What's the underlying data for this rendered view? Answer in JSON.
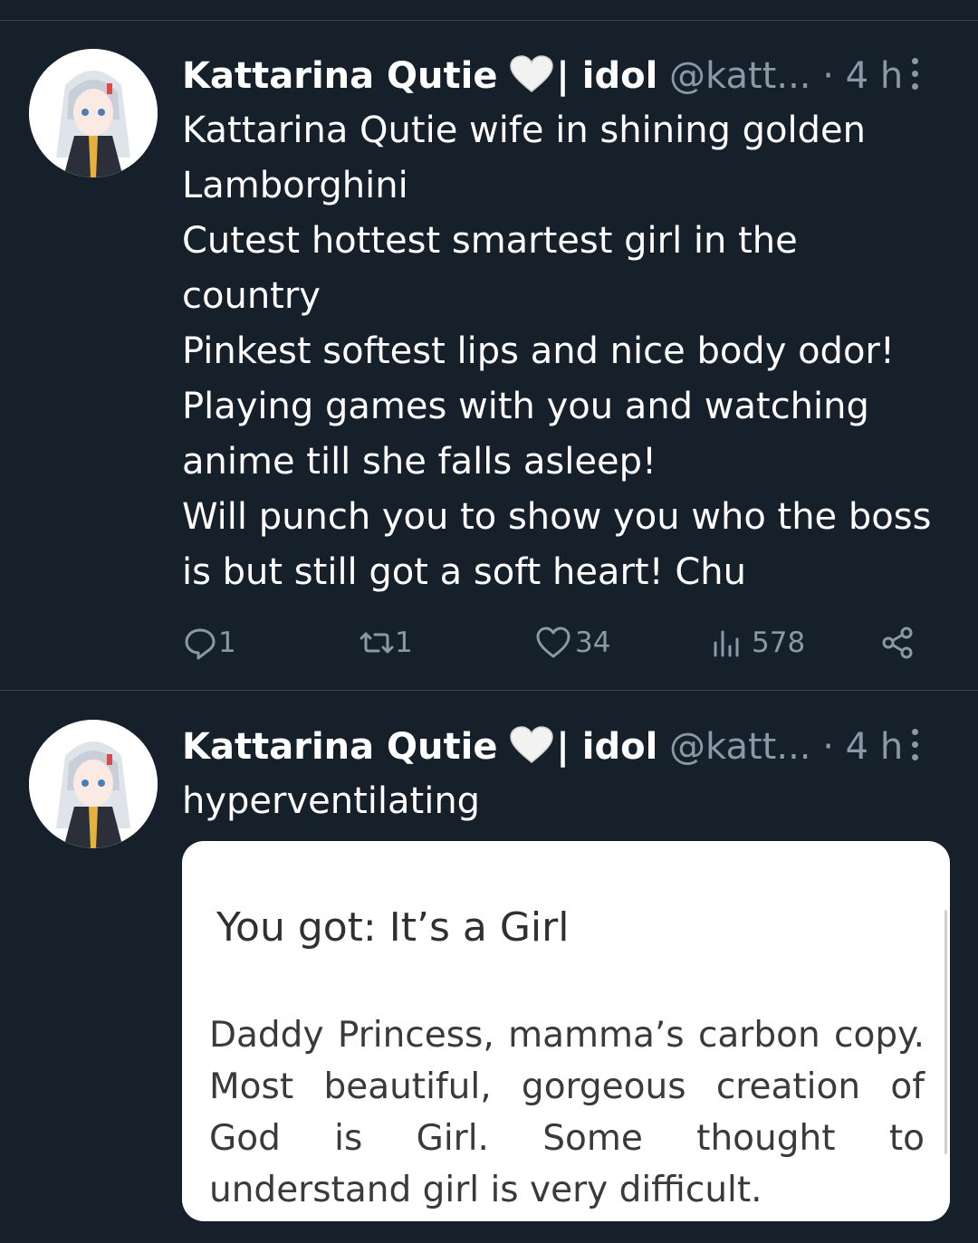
{
  "tweets": [
    {
      "author_name": "Kattarina Qutie",
      "author_suffix": "| idol",
      "handle": "@katt...",
      "dot": "·",
      "time": "4 h",
      "text": "Kattarina Qutie wife in shining golden\nLamborghini\nCutest hottest smartest girl in the\ncountry\nPinkest softest lips and nice body odor!\nPlaying games with you and watching\nanime till she falls asleep!\nWill punch you to show you who the boss\nis but still got a soft heart! Chu",
      "stats": {
        "replies": "1",
        "retweets": "1",
        "likes": "34",
        "views": "578"
      }
    },
    {
      "author_name": "Kattarina Qutie",
      "author_suffix": "| idol",
      "handle": "@katt...",
      "dot": "·",
      "time": "4 h",
      "text": "hyperventilating",
      "card": {
        "title": "You got: It’s a Girl",
        "text": "Daddy Princess, mamma’s carbon copy. Most beautiful, gorgeous creation of God is Girl. Some thought to understand girl is very difficult."
      }
    }
  ],
  "icons": [
    "more-vertical-icon",
    "white-heart-icon",
    "reply-icon",
    "retweet-icon",
    "like-icon",
    "views-icon",
    "share-icon"
  ],
  "colors": {
    "background": "#15202b",
    "muted": "#8b98a5",
    "divider": "#38444d",
    "text": "#ffffff"
  }
}
